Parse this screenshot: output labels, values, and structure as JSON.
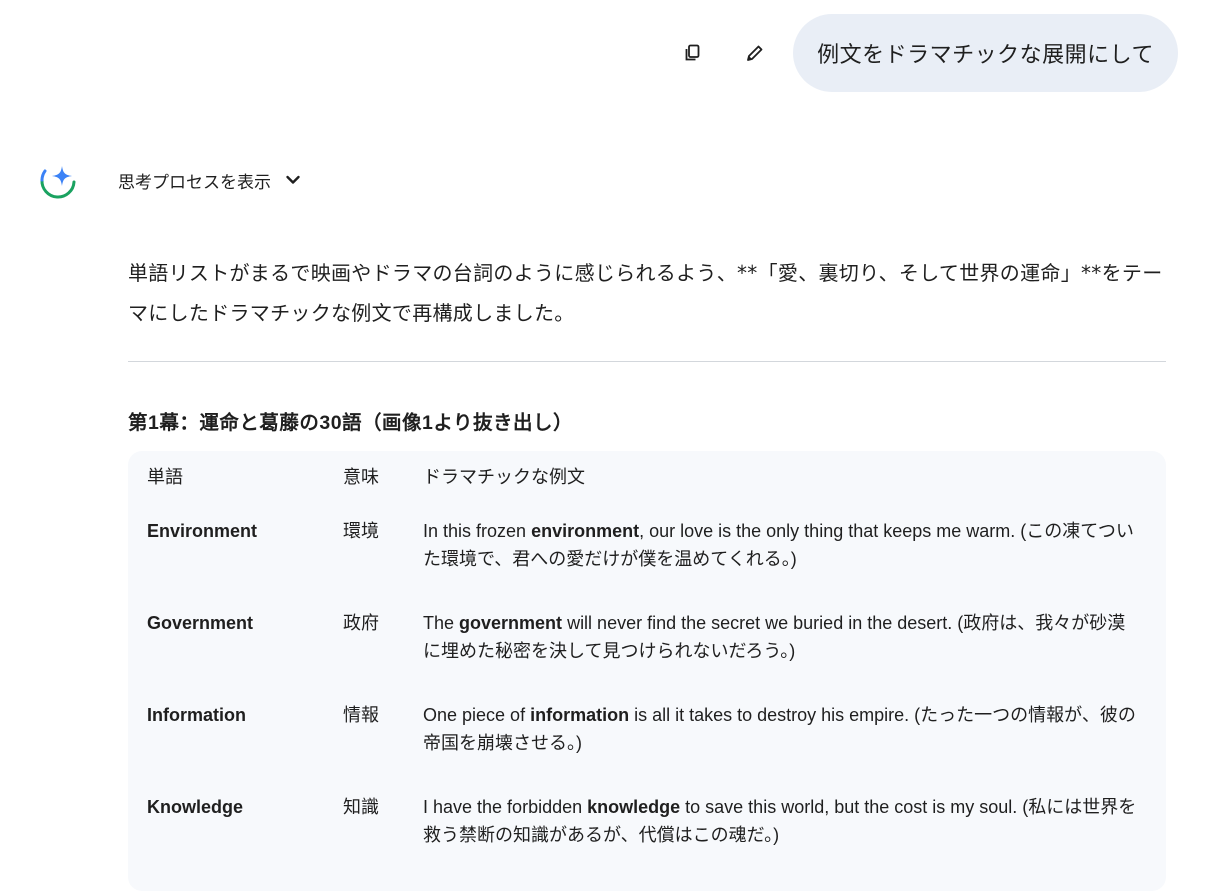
{
  "user_prompt": {
    "text": "例文をドラマチックな展開にして",
    "copy_icon": "copy-icon",
    "edit_icon": "edit-pencil-icon"
  },
  "thinking": {
    "label": "思考プロセスを表示",
    "logo_icon": "gemini-spark-icon",
    "toggle_icon": "chevron-down-icon"
  },
  "answer": {
    "intro": "単語リストがまるで映画やドラマの台詞のように感じられるよう、**「愛、裏切り、そして世界の運命」**をテーマにしたドラマチックな例文で再構成しました。",
    "section_title": "第1幕：運命と葛藤の30語（画像1より抜き出し）",
    "table": {
      "headers": [
        "単語",
        "意味",
        "ドラマチックな例文"
      ],
      "rows": [
        {
          "word": "Environment",
          "meaning": "環境",
          "ex_before": "In this frozen ",
          "ex_bold": "environment",
          "ex_after": ", our love is the only thing that keeps me warm. (この凍てついた環境で、君への愛だけが僕を温めてくれる。)"
        },
        {
          "word": "Government",
          "meaning": "政府",
          "ex_before": "The ",
          "ex_bold": "government",
          "ex_after": " will never find the secret we buried in the desert. (政府は、我々が砂漠に埋めた秘密を決して見つけられないだろう。)"
        },
        {
          "word": "Information",
          "meaning": "情報",
          "ex_before": "One piece of ",
          "ex_bold": "information",
          "ex_after": " is all it takes to destroy his empire. (たった一つの情報が、彼の帝国を崩壊させる。)"
        },
        {
          "word": "Knowledge",
          "meaning": "知識",
          "ex_before": "I have the forbidden ",
          "ex_bold": "knowledge",
          "ex_after": " to save this world, but the cost is my soul. (私には世界を救う禁断の知識があるが、代償はこの魂だ。)"
        }
      ]
    }
  },
  "colors": {
    "bubble_bg": "#e9eef6",
    "table_bg": "#f7f9fc",
    "divider": "#d3d7dc",
    "gem_blue": "#3b82f6",
    "gem_green": "#1aa260"
  }
}
